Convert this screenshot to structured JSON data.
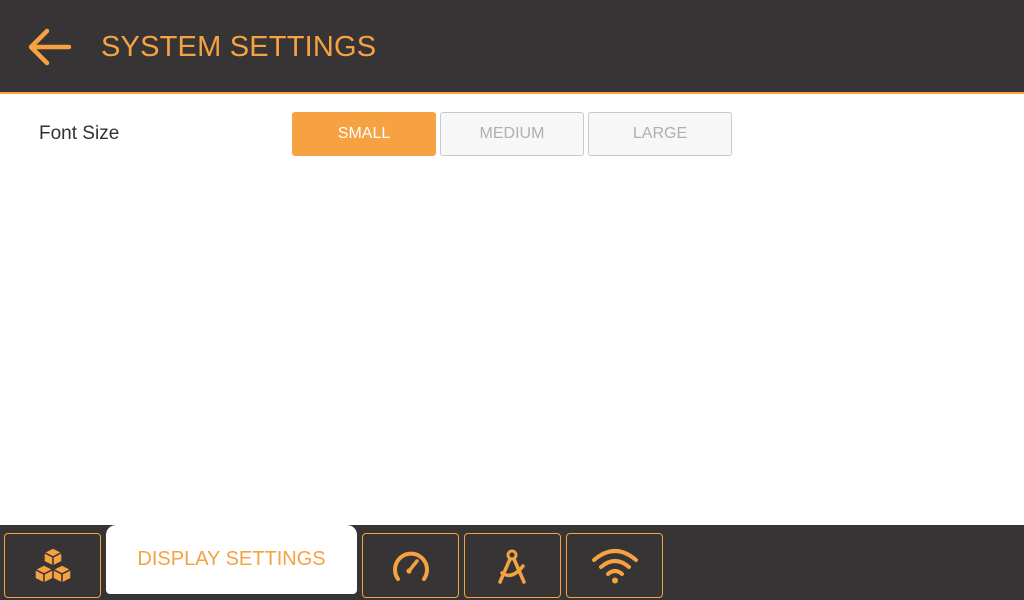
{
  "header": {
    "back_icon": "arrow-left-icon",
    "title": "SYSTEM SETTINGS"
  },
  "settings": {
    "font_size": {
      "label": "Font Size",
      "options": [
        "SMALL",
        "MEDIUM",
        "LARGE"
      ],
      "selected": "SMALL"
    }
  },
  "tabs": [
    {
      "icon": "cubes-icon",
      "label": ""
    },
    {
      "icon": "",
      "label": "DISPLAY SETTINGS",
      "active": true
    },
    {
      "icon": "speedometer-icon",
      "label": ""
    },
    {
      "icon": "compass-tool-icon",
      "label": ""
    },
    {
      "icon": "wifi-icon",
      "label": ""
    }
  ],
  "colors": {
    "accent": "#f6a142",
    "bar_background": "#363434",
    "content_background": "#ffffff",
    "label_text": "#333333",
    "inactive_button_text": "#b0b0b0"
  }
}
